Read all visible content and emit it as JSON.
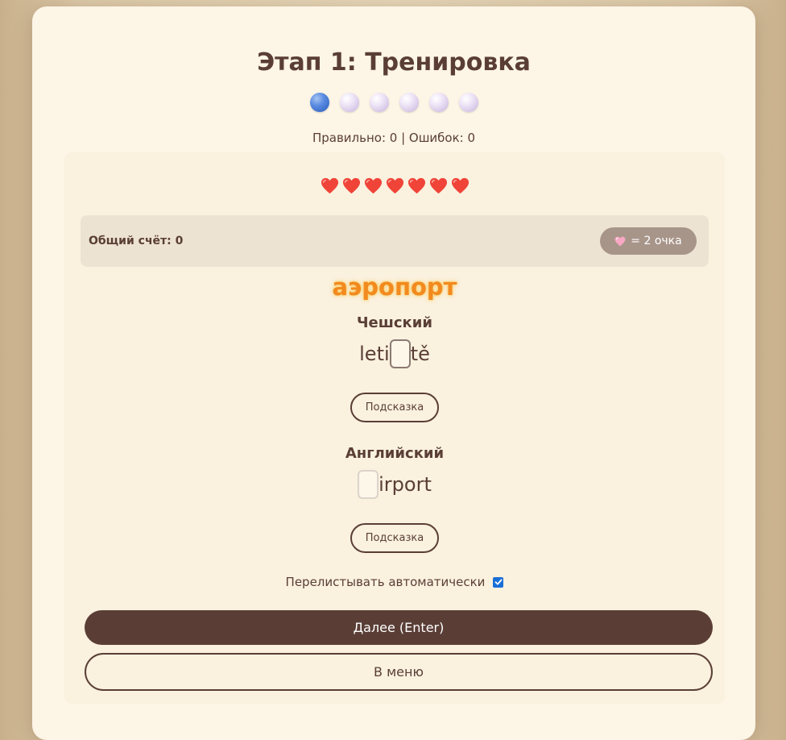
{
  "stage": {
    "title": "Этап 1: Тренировка",
    "progress_dots": {
      "total": 6,
      "current": 1
    },
    "stats": "Правильно: 0 | Ошибок: 0"
  },
  "lives": {
    "count": 7,
    "icon": "heart-icon",
    "color": "#f04438"
  },
  "score": {
    "label": "Общий счёт: 0",
    "badge_icon": "pink-heart-icon",
    "badge_text": "= 2 очка"
  },
  "word": "аэропорт",
  "languages": [
    {
      "name": "Чешский",
      "prefix": "leti",
      "suffix": "tě",
      "hint_label": "Подсказка"
    },
    {
      "name": "Английский",
      "prefix": "",
      "suffix": "irport",
      "hint_label": "Подсказка"
    }
  ],
  "auto_advance": {
    "label": "Перелистывать автоматически",
    "checked": true
  },
  "buttons": {
    "next_label": "Далее (Enter)",
    "menu_label": "В меню"
  },
  "colors": {
    "accent": "#5a3e36",
    "word": "#f28a1f",
    "active_dot": "#2a5bbd",
    "checkbox": "#1a6fd6"
  }
}
